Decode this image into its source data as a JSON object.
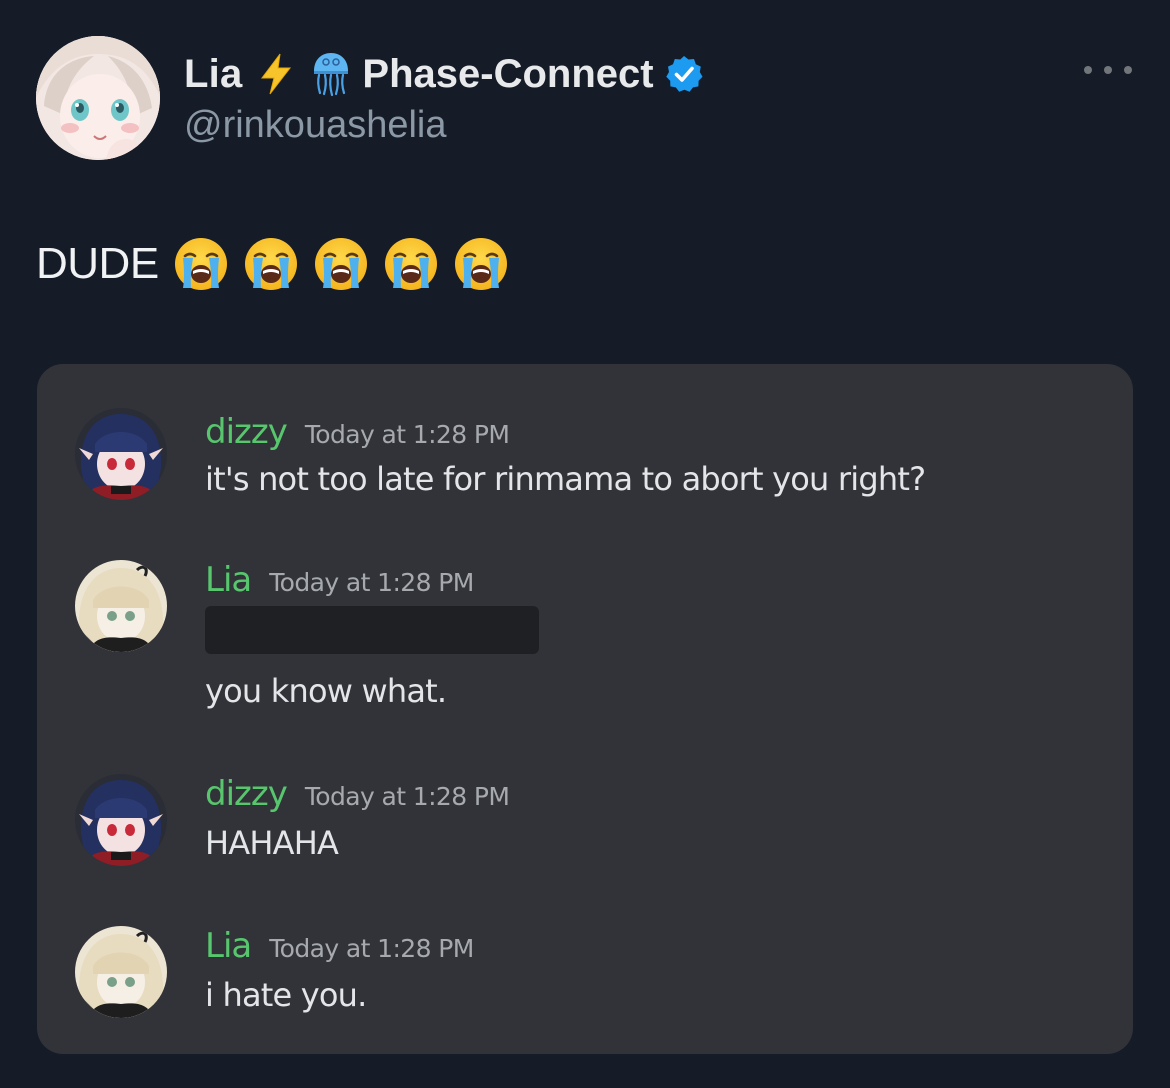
{
  "tweet": {
    "display_name": "Lia",
    "name_emojis": [
      "lightning-icon",
      "jellyfish-icon"
    ],
    "org_name": "Phase-Connect",
    "verified": true,
    "handle": "@rinkouashelia",
    "text": "DUDE",
    "text_emoji": "loudly-crying-face-icon",
    "text_emoji_count": 5
  },
  "discord_screenshot": {
    "messages": [
      {
        "author": "dizzy",
        "timestamp": "Today at 1:28 PM",
        "content": "it's not too late for rinmama to abort you right?"
      },
      {
        "author": "Lia",
        "timestamp": "Today at 1:28 PM",
        "content": "you know what.",
        "has_redacted_line": true
      },
      {
        "author": "dizzy",
        "timestamp": "Today at 1:28 PM",
        "content": "HAHAHA"
      },
      {
        "author": "Lia",
        "timestamp": "Today at 1:28 PM",
        "content": "i hate you."
      }
    ]
  },
  "colors": {
    "background": "#161c27",
    "card_background": "#313338",
    "discord_author_green": "#57c66d",
    "verified_blue": "#1d9bf0",
    "handle_gray": "#8b98a5"
  }
}
